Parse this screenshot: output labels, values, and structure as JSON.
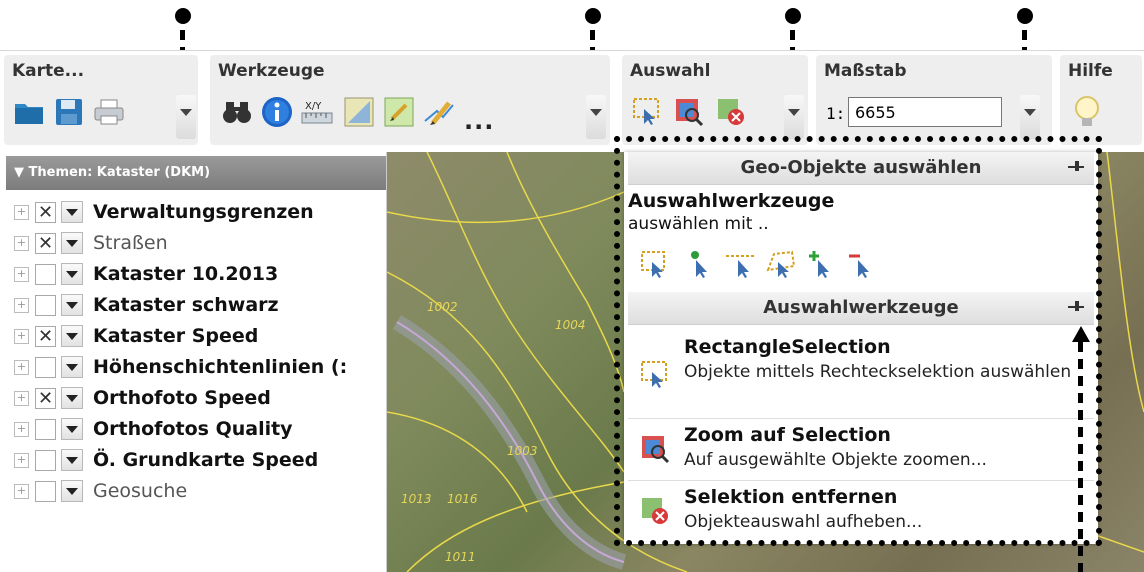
{
  "toolbar": {
    "karte": {
      "title": "Karte...",
      "icons": [
        "folder-icon",
        "save-icon",
        "print-icon"
      ]
    },
    "werkzeuge": {
      "title": "Werkzeuge",
      "icons": [
        "binoculars-icon",
        "info-icon",
        "xy-coordinates-icon",
        "measure-area-icon",
        "draw-icon",
        "edit-icon"
      ],
      "more": "..."
    },
    "auswahl": {
      "title": "Auswahl",
      "icons": [
        "rectangle-select-icon",
        "zoom-selection-icon",
        "remove-selection-icon"
      ]
    },
    "massstab": {
      "title": "Maßstab",
      "prefix": "1:",
      "value": "6655"
    },
    "hilfe": {
      "title": "Hilfe",
      "icons": [
        "lightbulb-icon"
      ]
    }
  },
  "layer_tree": {
    "header": "▼ Themen: Kataster (DKM)",
    "layers": [
      {
        "name": "Verwaltungsgrenzen",
        "checked": true,
        "bold": true
      },
      {
        "name": "Straßen",
        "checked": true,
        "bold": false
      },
      {
        "name": "Kataster 10.2013",
        "checked": false,
        "bold": true
      },
      {
        "name": "Kataster schwarz",
        "checked": false,
        "bold": true
      },
      {
        "name": "Kataster Speed",
        "checked": true,
        "bold": true
      },
      {
        "name": "Höhenschichtenlinien (:",
        "checked": false,
        "bold": true
      },
      {
        "name": "Orthofoto Speed",
        "checked": true,
        "bold": true
      },
      {
        "name": "Orthofotos Quality",
        "checked": false,
        "bold": true
      },
      {
        "name": "Ö. Grundkarte Speed",
        "checked": false,
        "bold": true
      },
      {
        "name": "Geosuche",
        "checked": false,
        "bold": false
      }
    ]
  },
  "map": {
    "labels": [
      "1002",
      "1004",
      "1003",
      "1013",
      "1016",
      "1011"
    ]
  },
  "selection_panel": {
    "geo_header": "Geo-Objekte auswählen",
    "tools_title": "Auswahlwerkzeuge",
    "tools_sub": "auswählen mit ..",
    "tool_icons": [
      "rectangle-select-icon",
      "point-select-icon",
      "line-select-icon",
      "polygon-select-icon",
      "add-select-icon",
      "subtract-select-icon"
    ],
    "tools_header": "Auswahlwerkzeuge",
    "options": [
      {
        "title": "RectangleSelection",
        "desc": "Objekte mittels Rechteckselektion auswählen"
      },
      {
        "title": "Zoom auf Selection",
        "desc": "Auf ausgewählte Objekte zoomen..."
      },
      {
        "title": "Selektion entfernen",
        "desc": "Objekteauswahl aufheben..."
      }
    ]
  },
  "colors": {
    "selection_dashed": "#f0c040",
    "header_gray": "#8a8a8a",
    "map_line": "#e8d84a"
  }
}
